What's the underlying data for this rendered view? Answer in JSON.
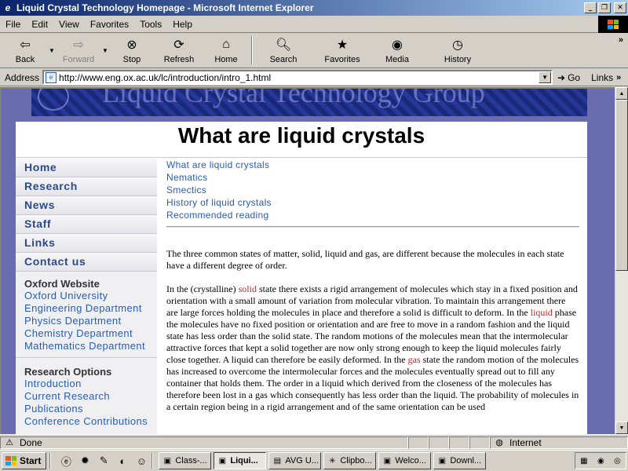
{
  "window": {
    "title": "Liquid Crystal Technology Homepage - Microsoft Internet Explorer",
    "minimize": "_",
    "restore": "❐",
    "close": "✕"
  },
  "menu": [
    {
      "label": "File"
    },
    {
      "label": "Edit"
    },
    {
      "label": "View"
    },
    {
      "label": "Favorites"
    },
    {
      "label": "Tools"
    },
    {
      "label": "Help"
    }
  ],
  "toolbar": {
    "back": "Back",
    "forward": "Forward",
    "stop": "Stop",
    "refresh": "Refresh",
    "home": "Home",
    "search": "Search",
    "favorites": "Favorites",
    "media": "Media",
    "history": "History",
    "more": "»"
  },
  "address": {
    "label": "Address",
    "url": "http://www.eng.ox.ac.uk/lc/introduction/intro_1.html",
    "go": "Go",
    "links": "Links",
    "more": "»"
  },
  "banner": {
    "text": "Liquid Crystal Technology Group"
  },
  "page": {
    "title": "What are liquid crystals"
  },
  "nav": {
    "buttons": [
      "Home",
      "Research",
      "News",
      "Staff",
      "Links",
      "Contact us"
    ],
    "oxford_heading": "Oxford Website",
    "oxford_links": [
      "Oxford University",
      "Engineering Department",
      "Physics Department",
      "Chemistry Department",
      "Mathematics Department"
    ],
    "research_heading": "Research Options",
    "research_links": [
      "Introduction",
      "Current Research",
      "Publications",
      "Conference Contributions"
    ]
  },
  "toc": [
    "What are liquid crystals",
    "Nematics",
    "Smectics",
    "History of liquid crystals",
    "Recommended reading"
  ],
  "content": {
    "p1": "The three common states of matter, solid, liquid and gas, are different because the molecules in each state have a different degree of order.",
    "p2_a": "In the (crystalline) ",
    "p2_solid": "solid",
    "p2_b": " state there exists a rigid arrangement of molecules which stay in a fixed position and orientation with a small amount of variation from molecular vibration. To maintain this arrangement there are large forces holding the molecules in place and therefore a solid is difficult to deform. In the ",
    "p2_liquid": "liquid",
    "p2_c": " phase the molecules have no fixed position or orientation and are free to move in a random fashion and the liquid state has less order than the solid state. The random motions of the molecules mean that the intermolecular attractive forces that kept a solid together are now only strong enough to keep the liquid molecules fairly close together. A liquid can therefore be easily deformed. In the ",
    "p2_gas": "gas",
    "p2_d": " state the random motion of the molecules has increased to overcome the intermolecular forces and the molecules eventually spread out to fill any container that holds them. The order in a liquid which derived from the closeness of the molecules has therefore been lost in a gas which consequently has less order than the liquid. The probability of molecules in a certain region being in a rigid arrangement and of the same orientation can be used"
  },
  "status": {
    "text": "Done",
    "zone": "Internet"
  },
  "taskbar": {
    "start": "Start",
    "tasks": [
      {
        "label": "Class-...",
        "active": false
      },
      {
        "label": "Liqui...",
        "active": true
      },
      {
        "label": "AVG U...",
        "active": false
      },
      {
        "label": "Clipbo...",
        "active": false
      },
      {
        "label": "Welco...",
        "active": false
      },
      {
        "label": "Downl...",
        "active": false
      }
    ]
  },
  "colors": {
    "titlebar": "#0a246a",
    "link": "#2a5cb5",
    "state_word": "#cc2020",
    "page_bg": "#6a6cb0"
  }
}
